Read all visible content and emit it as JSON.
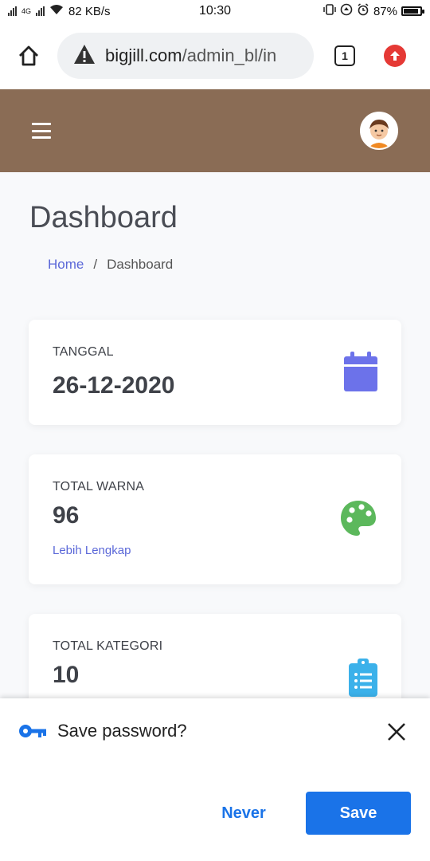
{
  "status_bar": {
    "network_speed": "82 KB/s",
    "time": "10:30",
    "battery": "87%",
    "signal_label": "4G"
  },
  "browser": {
    "url_domain": "bigjill.com",
    "url_path": "/admin_bl/in",
    "tab_count": "1"
  },
  "page": {
    "title": "Dashboard",
    "breadcrumb": {
      "home": "Home",
      "separator": "/",
      "current": "Dashboard"
    }
  },
  "cards": [
    {
      "label": "TANGGAL",
      "value": "26-12-2020",
      "icon": "calendar-icon",
      "color": "#6c72ea"
    },
    {
      "label": "TOTAL WARNA",
      "value": "96",
      "link": "Lebih Lengkap",
      "icon": "palette-icon",
      "color": "#5cb85c"
    },
    {
      "label": "TOTAL KATEGORI",
      "value": "10",
      "icon": "clipboard-list-icon",
      "color": "#3bb1ea"
    }
  ],
  "save_password": {
    "title": "Save password?",
    "never_label": "Never",
    "save_label": "Save"
  },
  "colors": {
    "header": "#8a6c55",
    "accent": "#1a73e8",
    "link": "#5a67d8"
  }
}
